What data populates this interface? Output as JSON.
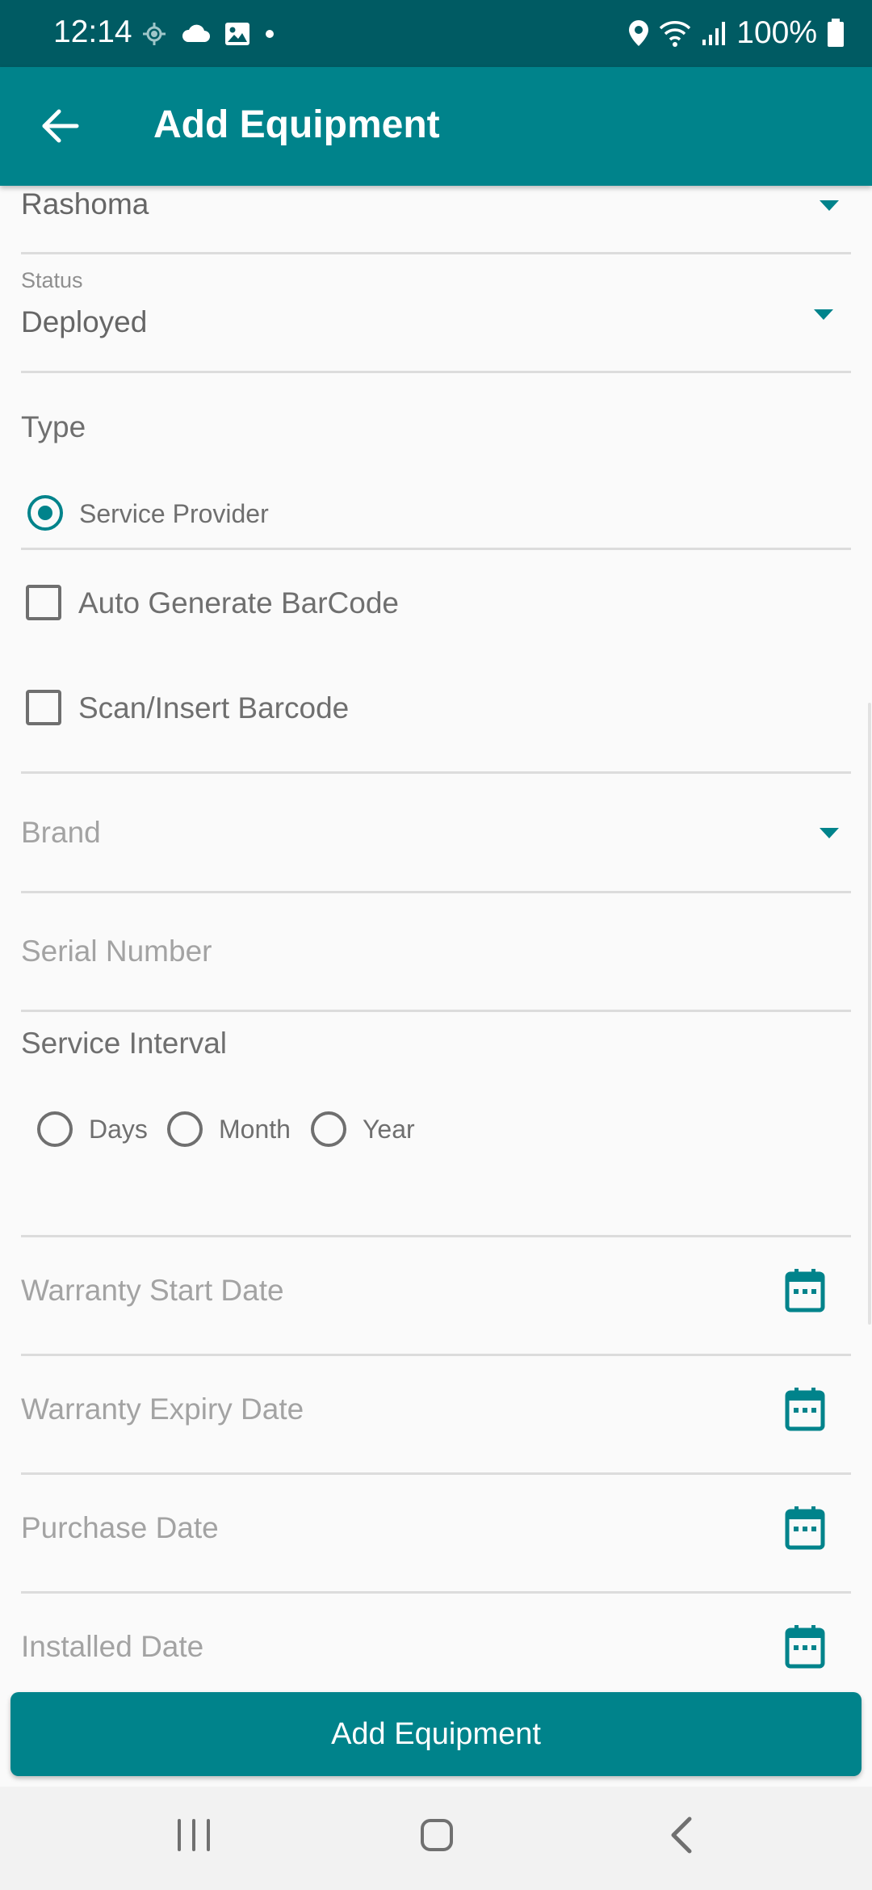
{
  "status_bar": {
    "time": "12:14",
    "battery": "100%",
    "icons_left": [
      "location-target-icon",
      "cloud-icon",
      "image-icon",
      "dot-icon"
    ],
    "icons_right": [
      "location-pin-icon",
      "wifi-icon",
      "signal-icon",
      "battery-icon"
    ]
  },
  "app_bar": {
    "title": "Add Equipment",
    "back_icon": "arrow-left-icon"
  },
  "form": {
    "site_value": "Rashoma",
    "status": {
      "label": "Status",
      "value": "Deployed"
    },
    "type": {
      "label": "Type",
      "option_label": "Service Provider",
      "selected": true
    },
    "auto_barcode_label": "Auto Generate BarCode",
    "scan_barcode_label": "Scan/Insert Barcode",
    "brand_placeholder": "Brand",
    "serial_placeholder": "Serial Number",
    "service_interval": {
      "label": "Service Interval",
      "options": [
        "Days",
        "Month",
        "Year"
      ]
    },
    "warranty_start_placeholder": "Warranty Start Date",
    "warranty_expiry_placeholder": "Warranty Expiry Date",
    "purchase_date_placeholder": "Purchase Date",
    "installed_date_placeholder": "Installed Date"
  },
  "primary_button": {
    "label": "Add Equipment"
  },
  "colors": {
    "primary": "#00838b",
    "status_bar": "#005b63",
    "background": "#fafafa"
  }
}
